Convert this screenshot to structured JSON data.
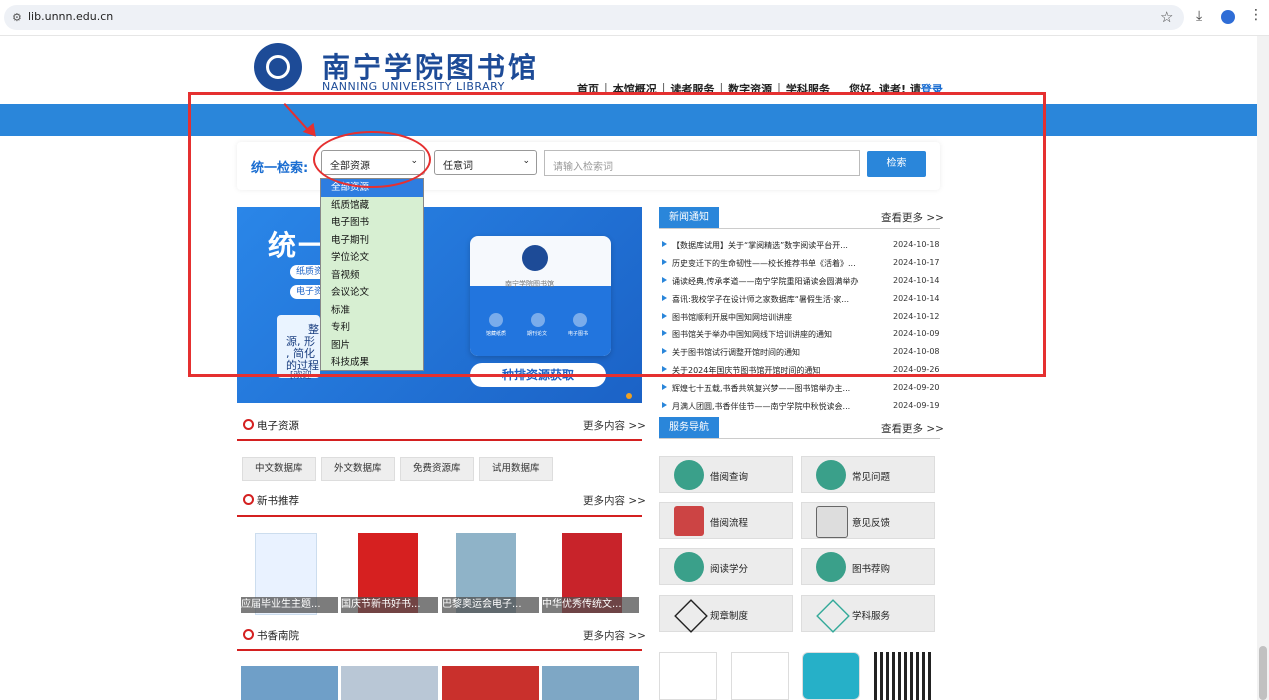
{
  "browser": {
    "url": "lib.unnn.edu.cn"
  },
  "header": {
    "logo_title": "南宁学院图书馆",
    "logo_subtitle": "NANNING UNIVERSITY LIBRARY",
    "nav": [
      "首页",
      "本馆概况",
      "读者服务",
      "数字资源",
      "学科服务"
    ],
    "greeting": "您好, 读者! 请",
    "login": "登录"
  },
  "search": {
    "label": "统一检索:",
    "resource_selected": "全部资源",
    "field_selected": "任意词",
    "placeholder": "请输入检索词",
    "button": "检索",
    "dropdown_options": [
      "全部资源",
      "纸质馆藏",
      "电子图书",
      "电子期刊",
      "学位论文",
      "音视频",
      "会议论文",
      "标准",
      "专利",
      "图片",
      "科技成果"
    ]
  },
  "banner": {
    "big_text": "统一",
    "pills": [
      "纸质资",
      "电子资"
    ],
    "side_text": [
      "整",
      "源, 形",
      ", 简化",
      "的过程",
      "[欢迎"
    ],
    "lib_name": "南宁学院图书馆",
    "icon_labels": [
      "馆藏纸质",
      "期刊论文",
      "电子图书"
    ],
    "button": "种排资源获取"
  },
  "news": {
    "tab": "新闻通知",
    "more": "查看更多 >>",
    "items": [
      {
        "title": "【数据库试用】关于“掌阅精选”数字阅读平台开...",
        "date": "2024-10-18"
      },
      {
        "title": "历史变迁下的生命韧性——校长推荐书单《活着》...",
        "date": "2024-10-17"
      },
      {
        "title": "诵读经典,传承孝道——南宁学院重阳诵读会圆满举办",
        "date": "2024-10-14"
      },
      {
        "title": "喜讯:我校学子在设计师之家数据库“暑假生活·家...",
        "date": "2024-10-14"
      },
      {
        "title": "图书馆顺利开展中国知网培训讲座",
        "date": "2024-10-12"
      },
      {
        "title": "图书馆关于举办中国知网线下培训讲座的通知",
        "date": "2024-10-09"
      },
      {
        "title": "关于图书馆试行调整开馆时间的通知",
        "date": "2024-10-08"
      },
      {
        "title": "关于2024年国庆节图书馆开馆时间的通知",
        "date": "2024-09-26"
      },
      {
        "title": "辉煌七十五载,书香共筑复兴梦——图书馆举办主...",
        "date": "2024-09-20"
      },
      {
        "title": "月满人团圆,书香伴佳节——南宁学院中秋悦读会...",
        "date": "2024-09-19"
      }
    ]
  },
  "eresources": {
    "title": "电子资源",
    "more": "更多内容 >>",
    "tabs": [
      "中文数据库",
      "外文数据库",
      "免费资源库",
      "试用数据库"
    ]
  },
  "newbooks": {
    "title": "新书推荐",
    "more": "更多内容 >>",
    "items": [
      "应届毕业生主题...",
      "国庆节新书好书...",
      "巴黎奥运会电子...",
      "中华优秀传统文..."
    ]
  },
  "shuxiang": {
    "title": "书香南院",
    "more": "更多内容 >>"
  },
  "services": {
    "tab": "服务导航",
    "more": "查看更多 >>",
    "items": [
      "借阅查询",
      "常见问题",
      "借阅流程",
      "意见反馈",
      "阅读学分",
      "图书荐购",
      "规章制度",
      "学科服务"
    ]
  },
  "colors": {
    "accent": "#2a86da",
    "highlight": "#e53030",
    "section_red": "#d42020"
  }
}
